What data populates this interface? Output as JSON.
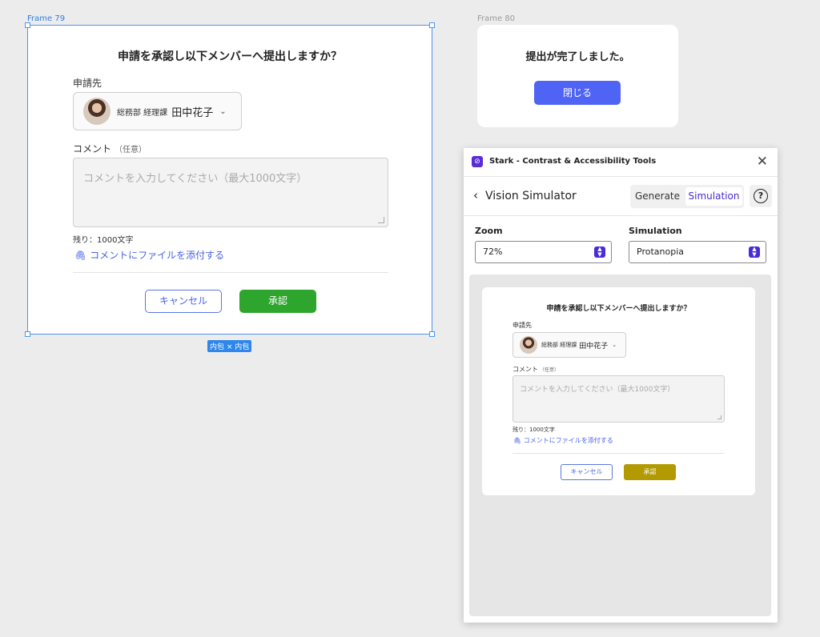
{
  "frame79": {
    "label": "Frame 79",
    "size_badge": "内包 × 内包",
    "title": "申請を承認し以下メンバーへ提出しますか？",
    "recipient_label": "申請先",
    "user": {
      "dept": "総務部 経理課",
      "name": "田中花子"
    },
    "comment_label": "コメント",
    "comment_optional": "（任意）",
    "comment_placeholder": "コメントを入力してください（最大1000文字）",
    "remaining": "残り：1000文字",
    "attach_label": "コメントにファイルを添付する",
    "cancel_label": "キャンセル",
    "approve_label": "承認",
    "approve_color": "#2ea52c"
  },
  "frame80": {
    "label": "Frame 80",
    "title": "提出が完了しました。",
    "close_label": "閉じる"
  },
  "stark": {
    "title": "Stark - Contrast & Accessibility Tools",
    "page_title": "Vision Simulator",
    "tabs": {
      "generate": "Generate",
      "simulation": "Simulation"
    },
    "zoom_label": "Zoom",
    "zoom_value": "72%",
    "simulation_label": "Simulation",
    "simulation_value": "Protanopia",
    "preview_approve_color": "#b29a00"
  }
}
